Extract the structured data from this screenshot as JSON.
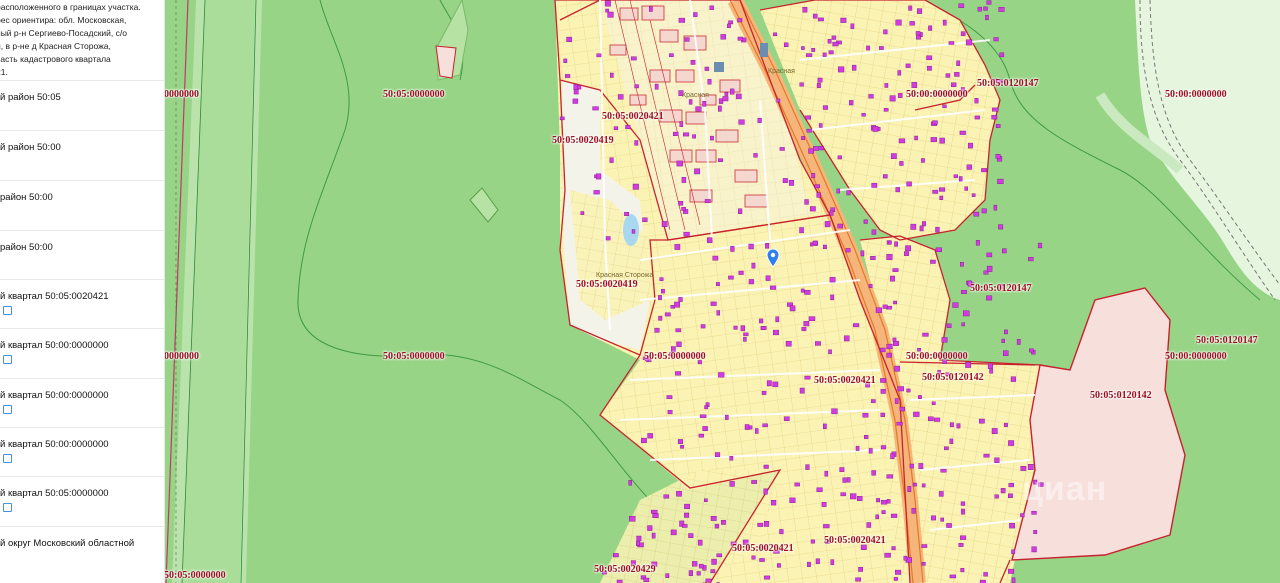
{
  "sidebar": {
    "address_lines": [
      "расположенного в границах участка.",
      "рес ориентира: обл. Московская,",
      "ный р-н Сергиево-Посадский, с/о",
      "й, в р-не д Красная Сторожа,",
      "часть кадастрового квартала",
      "21."
    ],
    "rows": [
      {
        "label": "й район 50:05",
        "icon": false
      },
      {
        "label": "й район 50:00",
        "icon": false
      },
      {
        "label": "район 50:00",
        "icon": false
      },
      {
        "label": "район 50:00",
        "icon": false
      },
      {
        "label": "й квартал 50:05:0020421",
        "icon": true
      },
      {
        "label": "й квартал 50:00:0000000",
        "icon": true
      },
      {
        "label": "й квартал 50:00:0000000",
        "icon": true
      },
      {
        "label": "й квартал 50:00:0000000",
        "icon": true
      },
      {
        "label": "й квартал 50:05:0000000",
        "icon": true
      },
      {
        "label": "й округ Московский областной",
        "icon": false
      }
    ],
    "row_icon_name": "copy-icon"
  },
  "map": {
    "colors": {
      "forest": "#97d486",
      "settlement": "#fbf3b4",
      "boundary": "#c8222e",
      "parcel": "#d23be0",
      "highlight": "#f7dfdc"
    },
    "labels": [
      {
        "name": "label-50-05-0000000-left-top",
        "text": "0000000"
      },
      {
        "name": "label-50-05-0000000-top",
        "text": "50:05:0000000"
      },
      {
        "name": "label-50-05-0000000-center",
        "text": "50:05:0000000"
      },
      {
        "name": "label-50-05-0020421-a",
        "text": "50:05:0020421"
      },
      {
        "name": "label-50-05-0020419-a",
        "text": "50:05:0020419"
      },
      {
        "name": "label-50-00-0000000-a",
        "text": "50:00:0000000"
      },
      {
        "name": "label-50-05-0120147-a",
        "text": "50:05:0120147"
      },
      {
        "name": "label-50-00-0000000-right-top",
        "text": "50:00:0000000"
      },
      {
        "name": "label-50-05-0120147-b",
        "text": "50:05:0120147"
      },
      {
        "name": "label-50-05-0020419-b",
        "text": "50:05:0020419"
      },
      {
        "name": "label-50-05-0000000-left-mid",
        "text": "0000000"
      },
      {
        "name": "label-50-05-0000000-bottom",
        "text": "50:05:0000000"
      },
      {
        "name": "label-50-05-0000000-mid",
        "text": "50:05:0000000"
      },
      {
        "name": "label-50-05-0020421-b",
        "text": "50:05:0020421"
      },
      {
        "name": "label-50-00-0000000-b",
        "text": "50:00:0000000"
      },
      {
        "name": "label-50-05-0120142-a",
        "text": "50:05:0120142"
      },
      {
        "name": "label-50-05-0120147-c",
        "text": "50:05:0120147"
      },
      {
        "name": "label-50-00-0000000-c",
        "text": "50:00:0000000"
      },
      {
        "name": "label-50-05-0120142-b",
        "text": "50:05:0120142"
      },
      {
        "name": "label-50-05-0020421-c",
        "text": "50:05:0020421"
      },
      {
        "name": "label-50-05-0020421-d",
        "text": "50:05:0020421"
      },
      {
        "name": "label-50-05-0020429",
        "text": "50:05:0020429"
      }
    ],
    "place_names": [
      "Красная",
      "Красная Сторожа",
      "Красная"
    ],
    "watermark": "циан"
  }
}
